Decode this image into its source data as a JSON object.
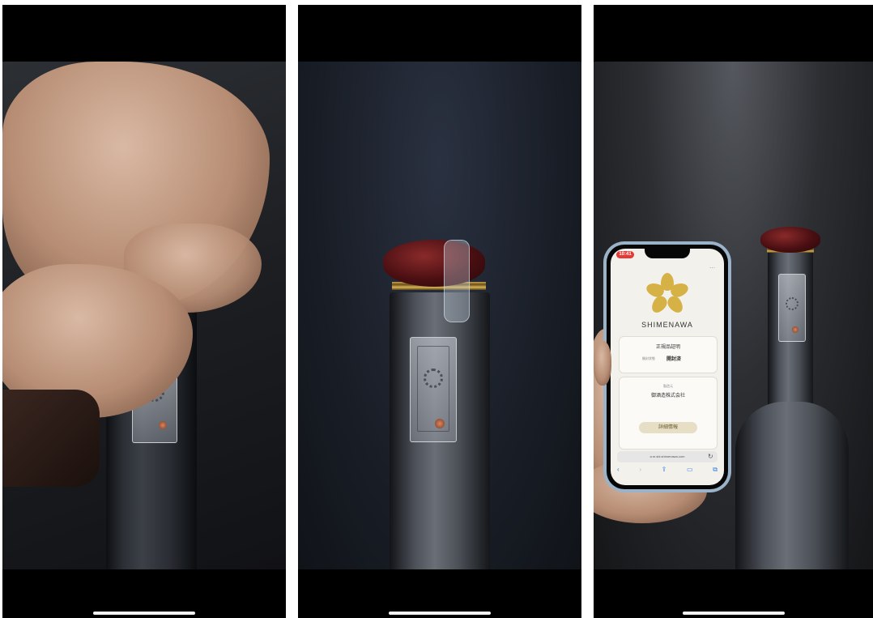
{
  "panels": [
    {
      "name": "panel-opening"
    },
    {
      "name": "panel-opened-bottle"
    },
    {
      "name": "panel-phone-verification"
    }
  ],
  "phone": {
    "status_time": "10:41",
    "brand": "SHIMENAWA",
    "card1_title": "正規品証明",
    "card1_label": "開封状態",
    "card1_value": "開封済",
    "card2_label": "製造元",
    "card2_value": "御酒造株式会社",
    "button_label": "詳細情報",
    "url": "a.m.sbi.shimenawa.com"
  },
  "colors": {
    "cap": "#4a0f12",
    "logo_gold": "#d6b145",
    "time_pill": "#e53935"
  }
}
